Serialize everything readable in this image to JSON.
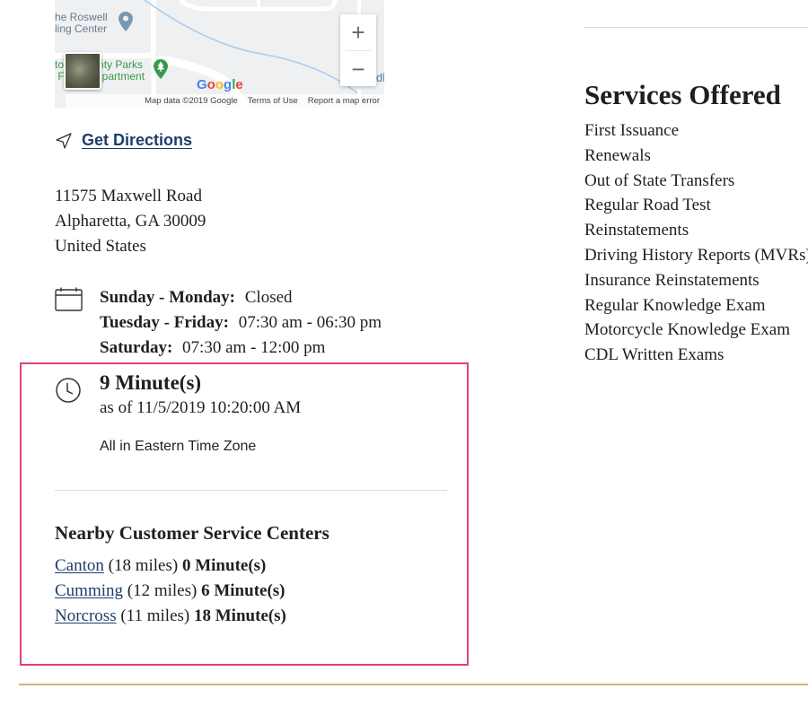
{
  "map": {
    "poi_1": [
      "he Roswell",
      "ling Center"
    ],
    "poi_2": [
      "to",
      "nty Parks",
      " F",
      "partment"
    ],
    "edge_label": "dl",
    "zoom_in_label": "+",
    "zoom_out_label": "−",
    "google_logo": [
      "G",
      "o",
      "o",
      "g",
      "l",
      "e"
    ],
    "attribution": {
      "map_data": "Map data ©2019 Google",
      "terms": "Terms of Use",
      "report": "Report a map error"
    }
  },
  "directions": {
    "icon": "navigation-arrow-icon",
    "label": "Get Directions"
  },
  "address": {
    "line1": "11575 Maxwell Road",
    "line2": "Alpharetta, GA 30009",
    "line3": "United States"
  },
  "hours": {
    "icon": "calendar-icon",
    "rows": [
      {
        "days": "Sunday - Monday:",
        "time": "Closed"
      },
      {
        "days": "Tuesday - Friday:",
        "time": "07:30 am - 06:30 pm"
      },
      {
        "days": "Saturday:",
        "time": "07:30 am - 12:00 pm"
      }
    ]
  },
  "wait_time": {
    "icon": "clock-icon",
    "title": "9 Minute(s)",
    "as_of": "as of 11/5/2019 10:20:00 AM",
    "timezone_note": "All in Eastern Time Zone"
  },
  "nearby": {
    "heading": "Nearby Customer Service Centers",
    "centers": [
      {
        "name": "Canton",
        "distance": "(18 miles)",
        "wait": "0 Minute(s)"
      },
      {
        "name": "Cumming",
        "distance": "(12 miles)",
        "wait": "6 Minute(s)"
      },
      {
        "name": "Norcross",
        "distance": "(11 miles)",
        "wait": "18 Minute(s)"
      }
    ]
  },
  "services": {
    "heading": "Services Offered",
    "items": [
      "First Issuance",
      "Renewals",
      "Out of State Transfers",
      "Regular Road Test",
      "Reinstatements",
      "Driving History Reports (MVRs)",
      "Insurance Reinstatements",
      "Regular Knowledge Exam",
      "Motorcycle Knowledge Exam",
      "CDL Written Exams"
    ]
  },
  "colors": {
    "link": "#1d3d6b",
    "highlight_border": "#e0407a",
    "footer_rule": "#d4b278"
  }
}
